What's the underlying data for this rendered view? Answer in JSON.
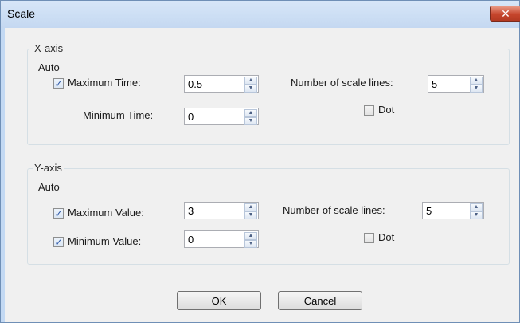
{
  "window": {
    "title": "Scale",
    "close_glyph": "✕"
  },
  "x_axis": {
    "legend": "X-axis",
    "auto_label": "Auto",
    "max": {
      "label": "Maximum Time:",
      "checked": true,
      "value": "0.5"
    },
    "min": {
      "label": "Minimum Time:",
      "value": "0"
    },
    "scale_lines": {
      "label": "Number of scale lines:",
      "value": "5"
    },
    "dot": {
      "label": "Dot",
      "checked": false
    }
  },
  "y_axis": {
    "legend": "Y-axis",
    "auto_label": "Auto",
    "max": {
      "label": "Maximum Value:",
      "checked": true,
      "value": "3"
    },
    "min": {
      "label": "Minimum Value:",
      "checked": true,
      "value": "0"
    },
    "scale_lines": {
      "label": "Number of scale lines:",
      "value": "5"
    },
    "dot": {
      "label": "Dot",
      "checked": false
    }
  },
  "buttons": {
    "ok": "OK",
    "cancel": "Cancel"
  },
  "glyphs": {
    "check": "✓",
    "up": "▲",
    "down": "▼"
  },
  "colors": {
    "title_bar": "#c4d8f1",
    "close_button": "#c6452c",
    "client_bg": "#f0f0f0",
    "check_mark": "#2a55a6"
  },
  "icons": [
    "close-icon",
    "check-icon",
    "spin-up-icon",
    "spin-down-icon"
  ]
}
